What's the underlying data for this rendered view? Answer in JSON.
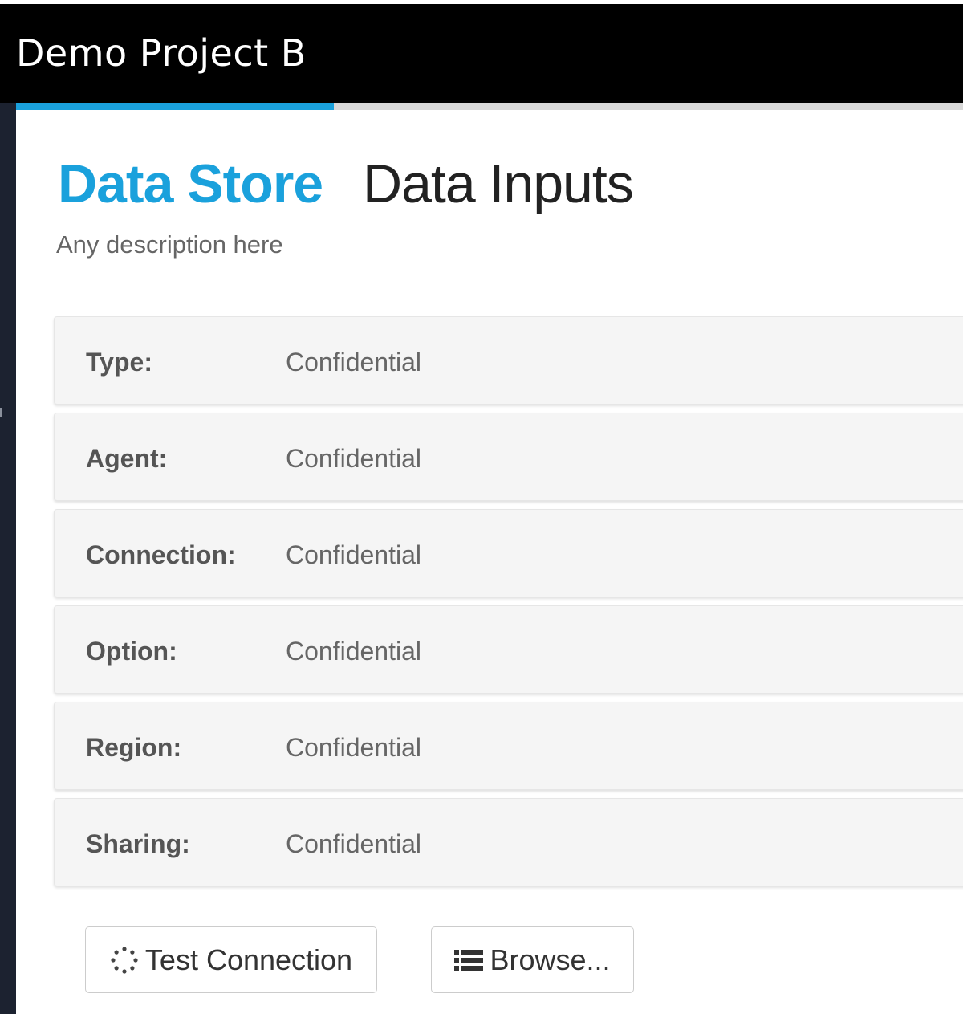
{
  "window": {
    "title": "Demo Project B"
  },
  "progress": {
    "fraction": 0.336,
    "fill_color": "#1aa1dc"
  },
  "header": {
    "tabs": [
      {
        "label": "Data Store",
        "active": true
      },
      {
        "label": "Data Inputs",
        "active": false
      }
    ],
    "description": "Any description here"
  },
  "details": {
    "rows": [
      {
        "label": "Type:",
        "value": "Confidential"
      },
      {
        "label": "Agent:",
        "value": "Confidential"
      },
      {
        "label": "Connection:",
        "value": "Confidential"
      },
      {
        "label": "Option:",
        "value": "Confidential"
      },
      {
        "label": "Region:",
        "value": "Confidential"
      },
      {
        "label": "Sharing:",
        "value": "Confidential"
      }
    ]
  },
  "actions": {
    "test_connection": {
      "label": "Test Connection",
      "icon": "spinner-icon"
    },
    "browse": {
      "label": "Browse...",
      "icon": "list-icon"
    }
  },
  "colors": {
    "accent": "#1aa1dc",
    "titlebar": "#000000"
  }
}
